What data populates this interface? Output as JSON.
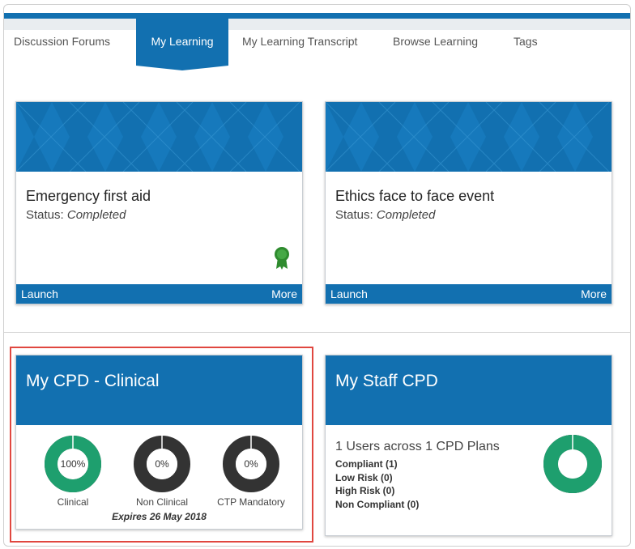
{
  "tabs": [
    {
      "label": "Discussion Forums",
      "active": false
    },
    {
      "label": "My Learning",
      "active": true
    },
    {
      "label": "My Learning Transcript",
      "active": false
    },
    {
      "label": "Browse Learning",
      "active": false
    },
    {
      "label": "Tags",
      "active": false
    }
  ],
  "courses": [
    {
      "title": "Emergency first aid",
      "status_label": "Status:",
      "status_value": "Completed",
      "launch_label": "Launch",
      "more_label": "More",
      "has_award": true
    },
    {
      "title": "Ethics face to face event",
      "status_label": "Status:",
      "status_value": "Completed",
      "launch_label": "Launch",
      "more_label": "More",
      "has_award": false
    }
  ],
  "cpd_clinical": {
    "title": "My CPD - Clinical",
    "rings": [
      {
        "value_label": "100%",
        "percent": 100,
        "caption": "Clinical"
      },
      {
        "value_label": "0%",
        "percent": 0,
        "caption": "Non Clinical"
      },
      {
        "value_label": "0%",
        "percent": 0,
        "caption": "CTP Mandatory"
      }
    ],
    "expires": "Expires 26 May 2018"
  },
  "staff_cpd": {
    "title": "My Staff CPD",
    "summary": "1 Users across 1 CPD Plans",
    "stats": [
      "Compliant (1)",
      "Low Risk (0)",
      "High Risk (0)",
      "Non Compliant (0)"
    ],
    "compliant_percent": 100
  },
  "colors": {
    "brand_blue": "#1270b0",
    "complete_green": "#1e9f6e",
    "empty_ring": "#333333",
    "highlight_red": "#e0473f",
    "award_green": "#2e8b2e"
  },
  "icons": {
    "award": "award-ribbon-icon"
  }
}
